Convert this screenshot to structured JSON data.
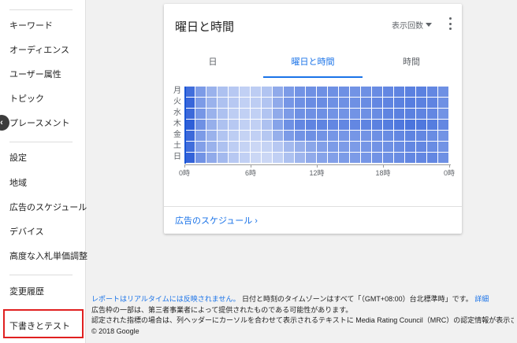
{
  "sidebar": {
    "items": [
      {
        "label": "キーワード"
      },
      {
        "label": "オーディエンス"
      },
      {
        "label": "ユーザー属性"
      },
      {
        "label": "トピック"
      },
      {
        "label": "プレースメント"
      },
      {
        "label": "設定"
      },
      {
        "label": "地域"
      },
      {
        "label": "広告のスケジュール"
      },
      {
        "label": "デバイス"
      },
      {
        "label": "高度な入札単価調整"
      },
      {
        "label": "変更履歴"
      },
      {
        "label": "下書きとテスト"
      }
    ],
    "collapse_icon": "chevron-left-icon"
  },
  "card": {
    "title": "曜日と時間",
    "metric_select": "表示回数",
    "tabs": [
      "日",
      "曜日と時間",
      "時間"
    ],
    "active_tab": "曜日と時間",
    "link_label": "広告のスケジュール",
    "link_chevron": "›"
  },
  "chart_data": {
    "type": "heatmap",
    "rows": [
      "月",
      "火",
      "水",
      "木",
      "金",
      "土",
      "日"
    ],
    "x_tick_labels": [
      "0時",
      "6時",
      "12時",
      "18時",
      "0時"
    ],
    "x_tick_hours": [
      0,
      6,
      12,
      18,
      24
    ],
    "hours": [
      0,
      1,
      2,
      3,
      4,
      5,
      6,
      7,
      8,
      9,
      10,
      11,
      12,
      13,
      14,
      15,
      16,
      17,
      18,
      19,
      20,
      21,
      22,
      23
    ],
    "intensity": [
      [
        0.85,
        0.55,
        0.4,
        0.3,
        0.25,
        0.2,
        0.22,
        0.28,
        0.45,
        0.55,
        0.6,
        0.62,
        0.62,
        0.62,
        0.62,
        0.6,
        0.62,
        0.65,
        0.68,
        0.7,
        0.72,
        0.72,
        0.68,
        0.62
      ],
      [
        0.9,
        0.55,
        0.4,
        0.3,
        0.25,
        0.2,
        0.22,
        0.28,
        0.45,
        0.58,
        0.62,
        0.65,
        0.65,
        0.62,
        0.62,
        0.62,
        0.65,
        0.68,
        0.7,
        0.72,
        0.74,
        0.72,
        0.7,
        0.62
      ],
      [
        0.88,
        0.58,
        0.4,
        0.3,
        0.22,
        0.2,
        0.2,
        0.28,
        0.45,
        0.55,
        0.62,
        0.62,
        0.62,
        0.6,
        0.6,
        0.6,
        0.62,
        0.65,
        0.7,
        0.72,
        0.72,
        0.7,
        0.68,
        0.6
      ],
      [
        0.95,
        0.62,
        0.42,
        0.3,
        0.25,
        0.2,
        0.2,
        0.3,
        0.5,
        0.62,
        0.68,
        0.7,
        0.7,
        0.68,
        0.68,
        0.68,
        0.7,
        0.72,
        0.75,
        0.78,
        0.8,
        0.78,
        0.75,
        0.68
      ],
      [
        0.88,
        0.55,
        0.4,
        0.28,
        0.22,
        0.18,
        0.2,
        0.26,
        0.42,
        0.55,
        0.6,
        0.62,
        0.6,
        0.58,
        0.58,
        0.58,
        0.6,
        0.62,
        0.65,
        0.68,
        0.7,
        0.68,
        0.65,
        0.6
      ],
      [
        0.85,
        0.52,
        0.4,
        0.3,
        0.22,
        0.18,
        0.15,
        0.18,
        0.25,
        0.35,
        0.42,
        0.48,
        0.52,
        0.55,
        0.55,
        0.55,
        0.58,
        0.6,
        0.62,
        0.65,
        0.68,
        0.68,
        0.65,
        0.6
      ],
      [
        0.92,
        0.6,
        0.45,
        0.35,
        0.25,
        0.2,
        0.15,
        0.15,
        0.2,
        0.3,
        0.38,
        0.45,
        0.5,
        0.52,
        0.55,
        0.55,
        0.58,
        0.6,
        0.62,
        0.65,
        0.68,
        0.68,
        0.68,
        0.62
      ]
    ],
    "color_low": "#e8eefb",
    "color_high": "#2457d6",
    "title": "",
    "xlabel": "",
    "ylabel": ""
  },
  "footer": {
    "realtime_note": "レポートはリアルタイムには反映されません。",
    "timezone_note": "日付と時刻のタイムゾーンはすべて「（GMT+08:00）台北標準時」です。",
    "details_link": "詳細",
    "line2": "広告枠の一部は、第三者事業者によって提供されたものである可能性があります。",
    "line3": "認定された指標の場合は、列ヘッダーにカーソルを合わせて表示されるテキストに Media Rating Council（MRC）の認定情報が表示されます。",
    "copyright": "© 2018 Google"
  },
  "colors": {
    "accent": "#1a73e8",
    "highlight_box": "#e02020"
  }
}
